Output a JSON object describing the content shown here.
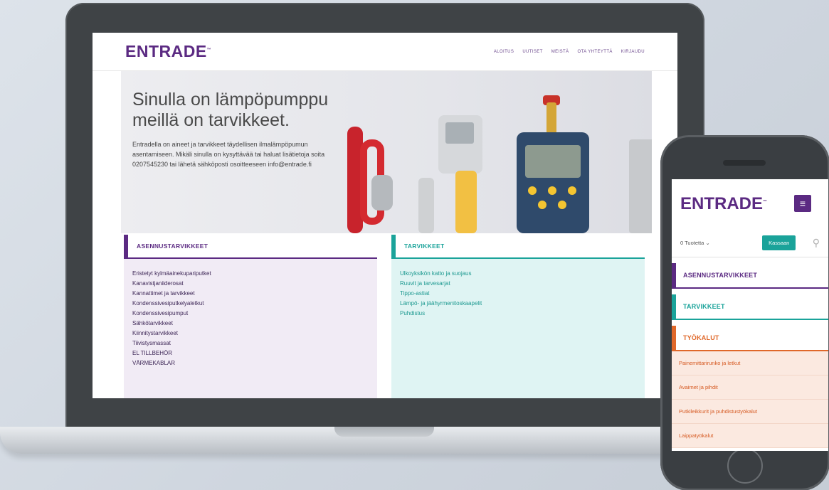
{
  "site": {
    "logo": "ENTRADE",
    "logo_tm": "™",
    "nav": [
      "ALOITUS",
      "UUTISET",
      "MEISTÄ",
      "OTA YHTEYTTÄ",
      "KIRJAUDU"
    ]
  },
  "hero": {
    "title_line1": "Sinulla on lämpöpumppu",
    "title_line2": "meillä on tarvikkeet.",
    "text": "Entradella on aineet ja tarvikkeet täydellisen ilmalämpöpumun asentamiseen. Mikäli sinulla on kysyttävää tai haluat lisätietoja soita 0207545230 tai lähetä sähköposti osoitteeseen info@entrade.fi"
  },
  "categories": {
    "asennus": {
      "title": "ASENNUSTARVIKKEET",
      "items": [
        "Eristetyt kylmäainekupariputket",
        "Kanavistjaniiderosat",
        "Kannattimet ja tarvikkeet",
        "Kondenssivesiputkelyaletkut",
        "Kondenssivesipumput",
        "Sähkötarvikkeet",
        "Kiinnitystarvikkeet",
        "Tiivistysmassat",
        "EL TILLBEHÖR",
        "VÄRMEKABLAR"
      ]
    },
    "tarvikkeet": {
      "title": "TARVIKKEET",
      "items": [
        "Ulkoyksikön katto ja suojaus",
        "Ruuvit ja tarvesarjat",
        "Tippo-astiat",
        "Lämpö- ja jäähyrmenitoskaapelit",
        "Puhdistus"
      ]
    }
  },
  "mobile": {
    "logo": "ENTRADE",
    "logo_tm": "™",
    "cart_count": "0 Tuotetta",
    "cart_chevron": "⌄",
    "checkout": "Kassaan",
    "categories": [
      "ASENNUSTARVIKKEET",
      "TARVIKKEET",
      "TYÖKALUT"
    ],
    "tyokalut_items": [
      "Painemittarirunko ja letkut",
      "Avaimet ja pihdit",
      "Putkileikkurit ja puhdistustyökalut",
      "Laippatyökalut"
    ]
  },
  "colors": {
    "brand_purple": "#5b2a82",
    "brand_teal": "#1aa39a",
    "brand_orange": "#e0682a"
  },
  "icons": {
    "menu": "hamburger-menu-icon",
    "search": "search-icon",
    "chevron": "chevron-down-icon"
  }
}
